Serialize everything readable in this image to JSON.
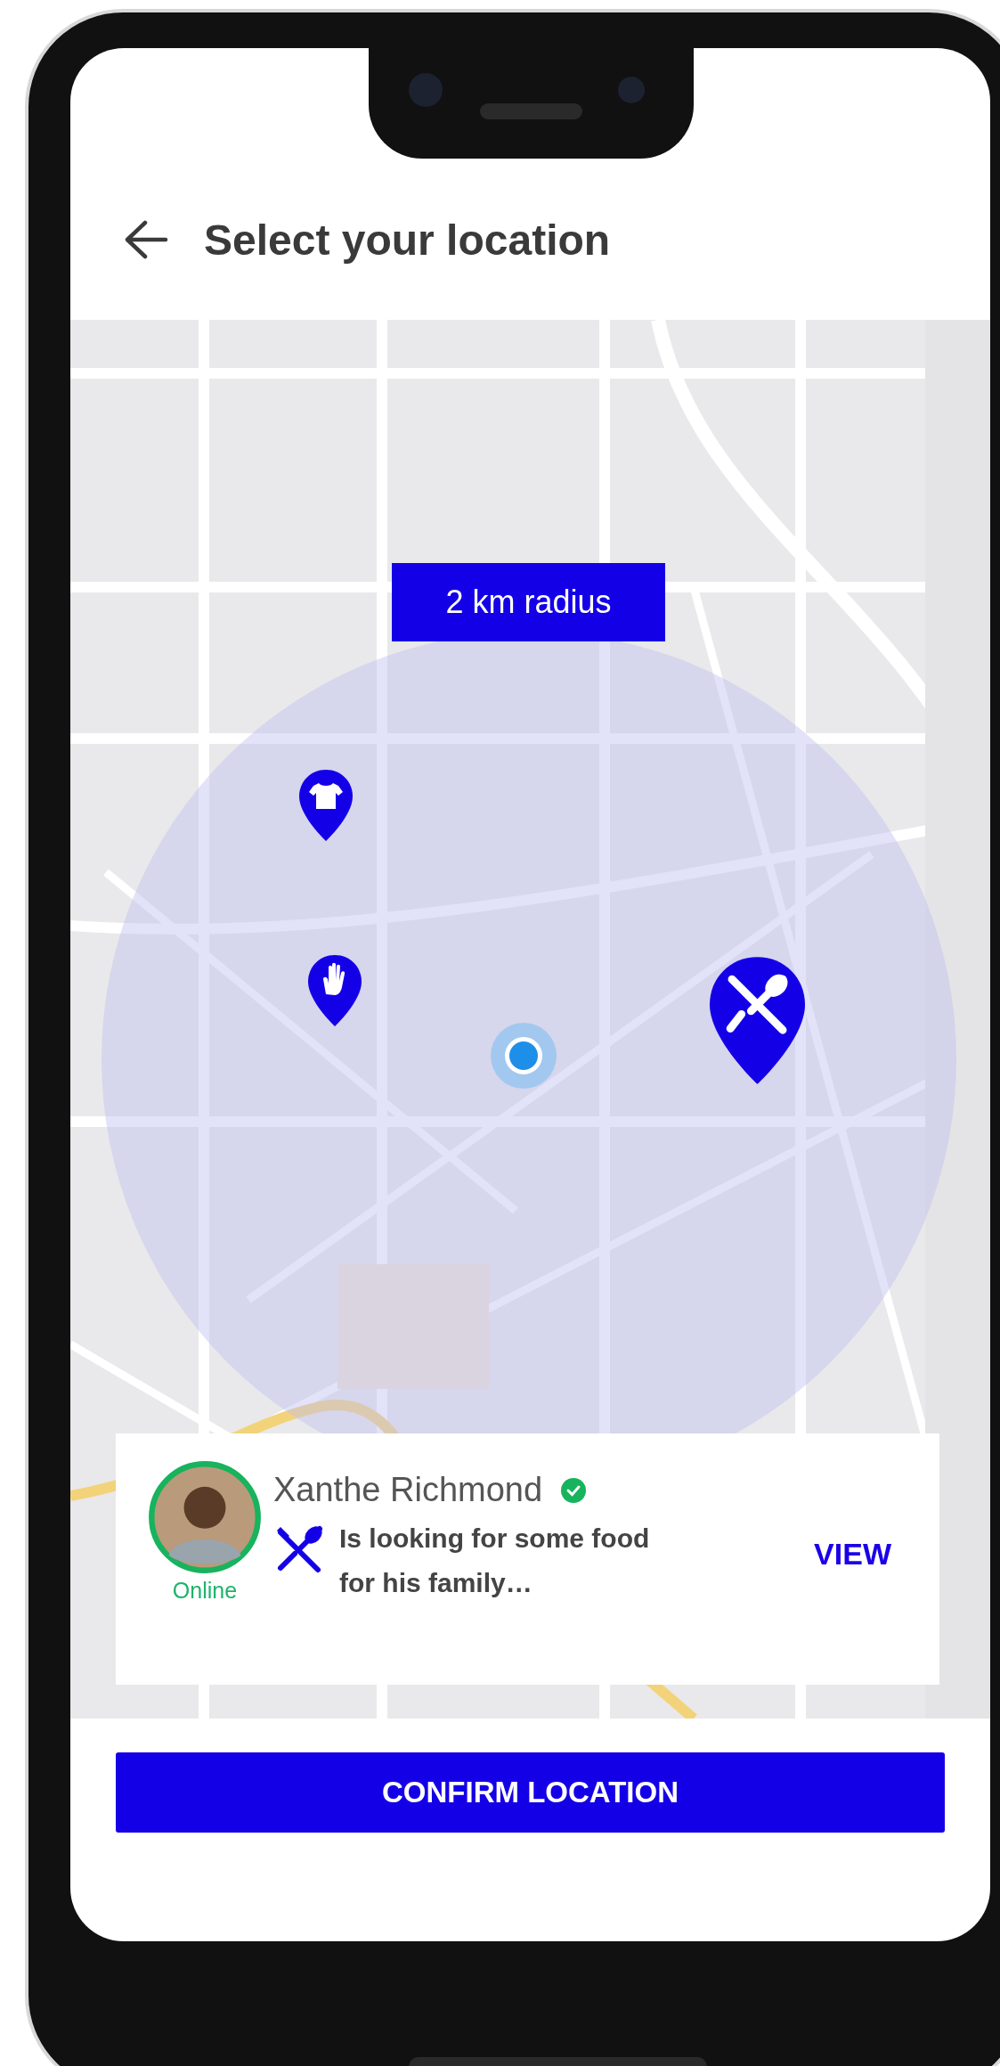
{
  "header": {
    "title": "Select your location"
  },
  "map": {
    "kind": "picture",
    "radius_label": "2 km radius",
    "markers": [
      {
        "kind": "shirt",
        "selected": false
      },
      {
        "kind": "hand",
        "selected": false
      },
      {
        "kind": "food",
        "selected": true
      }
    ]
  },
  "request_card": {
    "name": "Xanthe Richmond",
    "verified": true,
    "status": "Online",
    "kind": "food",
    "message": "Is looking for some food for his family…",
    "action": "VIEW"
  },
  "confirm_button": "CONFIRM LOCATION"
}
